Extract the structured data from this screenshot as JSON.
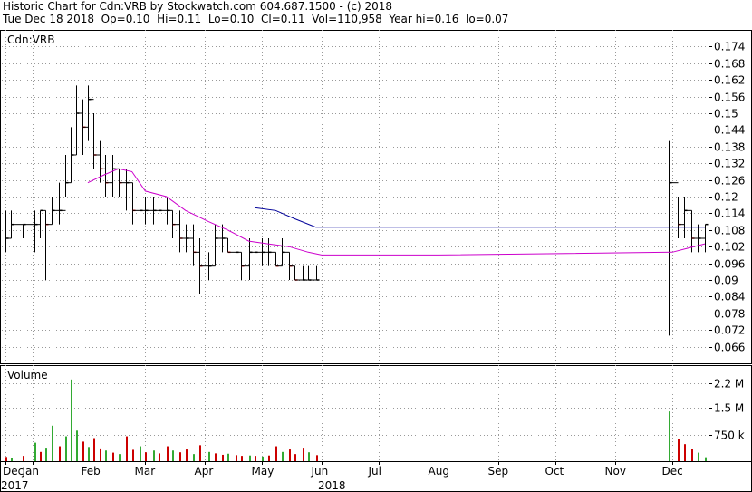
{
  "header": {
    "line1": "Historic Chart for Cdn:VRB by Stockwatch.com 604.687.1500 - (c) 2018",
    "line2": "Tue Dec 18 2018  Op=0.10  Hi=0.11  Lo=0.10  Cl=0.11  Vol=110,958  Year hi=0.16  lo=0.07"
  },
  "colors": {
    "up": "#000000",
    "down": "#cc0000",
    "ma_short": "#cc00cc",
    "ma_long": "#000099",
    "vol_up": "#33aa33",
    "vol_down": "#cc0000",
    "grid": "#999999"
  },
  "chart_data": [
    {
      "type": "ohlc",
      "panel": "price",
      "title": "Cdn:VRB",
      "ylim": [
        0.06,
        0.18
      ],
      "y_ticks": [
        "0.174",
        "0.168",
        "0.162",
        "0.156",
        "0.15",
        "0.144",
        "0.138",
        "0.132",
        "0.126",
        "0.12",
        "0.114",
        "0.108",
        "0.102",
        "0.096",
        "0.09",
        "0.084",
        "0.078",
        "0.072",
        "0.066"
      ],
      "x_ticks": [
        {
          "label": "Dec",
          "date": "2017-12-18"
        },
        {
          "label": "Jan",
          "date": "2018-01-01"
        },
        {
          "label": "Feb",
          "date": "2018-02-01"
        },
        {
          "label": "Mar",
          "date": "2018-03-01"
        },
        {
          "label": "Apr",
          "date": "2018-04-01"
        },
        {
          "label": "May",
          "date": "2018-05-01"
        },
        {
          "label": "Jun",
          "date": "2018-06-01"
        },
        {
          "label": "Jul",
          "date": "2018-07-01"
        },
        {
          "label": "Aug",
          "date": "2018-08-01"
        },
        {
          "label": "Sep",
          "date": "2018-09-01"
        },
        {
          "label": "Oct",
          "date": "2018-10-01"
        },
        {
          "label": "Nov",
          "date": "2018-11-01"
        },
        {
          "label": "Dec",
          "date": "2018-12-01"
        }
      ],
      "year_labels": [
        {
          "label": "2017",
          "date": "2017-12-18"
        },
        {
          "label": "2018",
          "date": "2018-06-01"
        }
      ],
      "x_range": [
        "2017-12-18",
        "2018-12-18"
      ],
      "bars": [
        {
          "date": "2017-12-18",
          "high": 0.115,
          "low": 0.1,
          "close": 0.105
        },
        {
          "date": "2017-12-21",
          "high": 0.115,
          "low": 0.105,
          "close": 0.11
        },
        {
          "date": "2017-12-27",
          "high": 0.11,
          "low": 0.105,
          "close": 0.11
        },
        {
          "date": "2018-01-02",
          "high": 0.115,
          "low": 0.1,
          "close": 0.11
        },
        {
          "date": "2018-01-05",
          "high": 0.115,
          "low": 0.105,
          "close": 0.115
        },
        {
          "date": "2018-01-08",
          "high": 0.115,
          "low": 0.09,
          "close": 0.11
        },
        {
          "date": "2018-01-11",
          "high": 0.12,
          "low": 0.11,
          "close": 0.115
        },
        {
          "date": "2018-01-15",
          "high": 0.125,
          "low": 0.11,
          "close": 0.115
        },
        {
          "date": "2018-01-18",
          "high": 0.135,
          "low": 0.12,
          "close": 0.125
        },
        {
          "date": "2018-01-21",
          "high": 0.145,
          "low": 0.125,
          "close": 0.135
        },
        {
          "date": "2018-01-24",
          "high": 0.16,
          "low": 0.135,
          "close": 0.15
        },
        {
          "date": "2018-01-27",
          "high": 0.155,
          "low": 0.135,
          "close": 0.145
        },
        {
          "date": "2018-01-30",
          "high": 0.16,
          "low": 0.14,
          "close": 0.155
        },
        {
          "date": "2018-02-02",
          "high": 0.15,
          "low": 0.13,
          "close": 0.135
        },
        {
          "date": "2018-02-05",
          "high": 0.14,
          "low": 0.125,
          "close": 0.13
        },
        {
          "date": "2018-02-08",
          "high": 0.135,
          "low": 0.12,
          "close": 0.125
        },
        {
          "date": "2018-02-12",
          "high": 0.135,
          "low": 0.12,
          "close": 0.13
        },
        {
          "date": "2018-02-15",
          "high": 0.13,
          "low": 0.12,
          "close": 0.125
        },
        {
          "date": "2018-02-19",
          "high": 0.13,
          "low": 0.115,
          "close": 0.125
        },
        {
          "date": "2018-02-22",
          "high": 0.125,
          "low": 0.11,
          "close": 0.115
        },
        {
          "date": "2018-02-26",
          "high": 0.12,
          "low": 0.105,
          "close": 0.115
        },
        {
          "date": "2018-03-01",
          "high": 0.12,
          "low": 0.11,
          "close": 0.115
        },
        {
          "date": "2018-03-05",
          "high": 0.12,
          "low": 0.11,
          "close": 0.115
        },
        {
          "date": "2018-03-08",
          "high": 0.12,
          "low": 0.11,
          "close": 0.115
        },
        {
          "date": "2018-03-12",
          "high": 0.12,
          "low": 0.11,
          "close": 0.115
        },
        {
          "date": "2018-03-15",
          "high": 0.115,
          "low": 0.105,
          "close": 0.11
        },
        {
          "date": "2018-03-19",
          "high": 0.115,
          "low": 0.1,
          "close": 0.105
        },
        {
          "date": "2018-03-22",
          "high": 0.11,
          "low": 0.1,
          "close": 0.105
        },
        {
          "date": "2018-03-26",
          "high": 0.11,
          "low": 0.095,
          "close": 0.1
        },
        {
          "date": "2018-03-29",
          "high": 0.105,
          "low": 0.085,
          "close": 0.095
        },
        {
          "date": "2018-04-03",
          "high": 0.1,
          "low": 0.09,
          "close": 0.095
        },
        {
          "date": "2018-04-06",
          "high": 0.11,
          "low": 0.095,
          "close": 0.105
        },
        {
          "date": "2018-04-10",
          "high": 0.11,
          "low": 0.1,
          "close": 0.105
        },
        {
          "date": "2018-04-13",
          "high": 0.105,
          "low": 0.1,
          "close": 0.1
        },
        {
          "date": "2018-04-17",
          "high": 0.105,
          "low": 0.095,
          "close": 0.1
        },
        {
          "date": "2018-04-20",
          "high": 0.1,
          "low": 0.09,
          "close": 0.095
        },
        {
          "date": "2018-04-24",
          "high": 0.105,
          "low": 0.09,
          "close": 0.1
        },
        {
          "date": "2018-04-27",
          "high": 0.105,
          "low": 0.095,
          "close": 0.1
        },
        {
          "date": "2018-05-01",
          "high": 0.105,
          "low": 0.095,
          "close": 0.1
        },
        {
          "date": "2018-05-04",
          "high": 0.105,
          "low": 0.095,
          "close": 0.1
        },
        {
          "date": "2018-05-08",
          "high": 0.1,
          "low": 0.095,
          "close": 0.095
        },
        {
          "date": "2018-05-11",
          "high": 0.105,
          "low": 0.095,
          "close": 0.1
        },
        {
          "date": "2018-05-15",
          "high": 0.1,
          "low": 0.09,
          "close": 0.095
        },
        {
          "date": "2018-05-18",
          "high": 0.095,
          "low": 0.09,
          "close": 0.09
        },
        {
          "date": "2018-05-22",
          "high": 0.095,
          "low": 0.09,
          "close": 0.09
        },
        {
          "date": "2018-05-25",
          "high": 0.095,
          "low": 0.09,
          "close": 0.09
        },
        {
          "date": "2018-05-29",
          "high": 0.095,
          "low": 0.09,
          "close": 0.09
        },
        {
          "date": "2018-11-29",
          "high": 0.14,
          "low": 0.07,
          "close": 0.125
        },
        {
          "date": "2018-12-04",
          "high": 0.12,
          "low": 0.105,
          "close": 0.11
        },
        {
          "date": "2018-12-07",
          "high": 0.12,
          "low": 0.105,
          "close": 0.115
        },
        {
          "date": "2018-12-11",
          "high": 0.115,
          "low": 0.1,
          "close": 0.105
        },
        {
          "date": "2018-12-14",
          "high": 0.11,
          "low": 0.1,
          "close": 0.105
        },
        {
          "date": "2018-12-18",
          "high": 0.11,
          "low": 0.1,
          "close": 0.11
        }
      ],
      "ma_short": [
        [
          "2018-01-30",
          0.125
        ],
        [
          "2018-02-08",
          0.128
        ],
        [
          "2018-02-15",
          0.13
        ],
        [
          "2018-02-22",
          0.129
        ],
        [
          "2018-03-01",
          0.122
        ],
        [
          "2018-03-12",
          0.12
        ],
        [
          "2018-03-22",
          0.115
        ],
        [
          "2018-04-03",
          0.111
        ],
        [
          "2018-04-13",
          0.108
        ],
        [
          "2018-04-24",
          0.104
        ],
        [
          "2018-05-04",
          0.103
        ],
        [
          "2018-05-15",
          0.102
        ],
        [
          "2018-05-25",
          0.1
        ],
        [
          "2018-06-01",
          0.099
        ],
        [
          "2018-08-01",
          0.099
        ],
        [
          "2018-12-01",
          0.1
        ],
        [
          "2018-12-18",
          0.103
        ]
      ],
      "ma_long": [
        [
          "2018-04-27",
          0.116
        ],
        [
          "2018-05-08",
          0.115
        ],
        [
          "2018-05-18",
          0.112
        ],
        [
          "2018-05-29",
          0.109
        ],
        [
          "2018-12-18",
          0.109
        ]
      ]
    },
    {
      "type": "bar",
      "panel": "volume",
      "title": "Volume",
      "ylim": [
        0,
        2500000
      ],
      "y_ticks": [
        "2.2 M",
        "1.5 M",
        "750 k"
      ],
      "bars": [
        {
          "date": "2017-12-18",
          "value": 120000,
          "dir": "down"
        },
        {
          "date": "2017-12-21",
          "value": 90000,
          "dir": "up"
        },
        {
          "date": "2017-12-27",
          "value": 150000,
          "dir": "down"
        },
        {
          "date": "2018-01-02",
          "value": 520000,
          "dir": "up"
        },
        {
          "date": "2018-01-05",
          "value": 260000,
          "dir": "down"
        },
        {
          "date": "2018-01-08",
          "value": 380000,
          "dir": "up"
        },
        {
          "date": "2018-01-11",
          "value": 1000000,
          "dir": "up"
        },
        {
          "date": "2018-01-15",
          "value": 420000,
          "dir": "down"
        },
        {
          "date": "2018-01-18",
          "value": 700000,
          "dir": "up"
        },
        {
          "date": "2018-01-21",
          "value": 2300000,
          "dir": "up"
        },
        {
          "date": "2018-01-24",
          "value": 860000,
          "dir": "up"
        },
        {
          "date": "2018-01-27",
          "value": 550000,
          "dir": "down"
        },
        {
          "date": "2018-01-30",
          "value": 400000,
          "dir": "up"
        },
        {
          "date": "2018-02-02",
          "value": 650000,
          "dir": "down"
        },
        {
          "date": "2018-02-05",
          "value": 360000,
          "dir": "down"
        },
        {
          "date": "2018-02-08",
          "value": 300000,
          "dir": "up"
        },
        {
          "date": "2018-02-12",
          "value": 240000,
          "dir": "down"
        },
        {
          "date": "2018-02-15",
          "value": 200000,
          "dir": "up"
        },
        {
          "date": "2018-02-19",
          "value": 700000,
          "dir": "down"
        },
        {
          "date": "2018-02-22",
          "value": 320000,
          "dir": "down"
        },
        {
          "date": "2018-02-26",
          "value": 420000,
          "dir": "up"
        },
        {
          "date": "2018-03-01",
          "value": 250000,
          "dir": "down"
        },
        {
          "date": "2018-03-05",
          "value": 300000,
          "dir": "up"
        },
        {
          "date": "2018-03-08",
          "value": 220000,
          "dir": "down"
        },
        {
          "date": "2018-03-12",
          "value": 420000,
          "dir": "down"
        },
        {
          "date": "2018-03-15",
          "value": 300000,
          "dir": "up"
        },
        {
          "date": "2018-03-19",
          "value": 250000,
          "dir": "down"
        },
        {
          "date": "2018-03-22",
          "value": 330000,
          "dir": "down"
        },
        {
          "date": "2018-03-26",
          "value": 200000,
          "dir": "up"
        },
        {
          "date": "2018-03-29",
          "value": 450000,
          "dir": "down"
        },
        {
          "date": "2018-04-03",
          "value": 260000,
          "dir": "up"
        },
        {
          "date": "2018-04-06",
          "value": 220000,
          "dir": "down"
        },
        {
          "date": "2018-04-10",
          "value": 180000,
          "dir": "down"
        },
        {
          "date": "2018-04-13",
          "value": 210000,
          "dir": "up"
        },
        {
          "date": "2018-04-17",
          "value": 170000,
          "dir": "down"
        },
        {
          "date": "2018-04-20",
          "value": 150000,
          "dir": "down"
        },
        {
          "date": "2018-04-24",
          "value": 160000,
          "dir": "up"
        },
        {
          "date": "2018-04-27",
          "value": 150000,
          "dir": "down"
        },
        {
          "date": "2018-05-01",
          "value": 130000,
          "dir": "up"
        },
        {
          "date": "2018-05-04",
          "value": 160000,
          "dir": "down"
        },
        {
          "date": "2018-05-08",
          "value": 420000,
          "dir": "down"
        },
        {
          "date": "2018-05-11",
          "value": 260000,
          "dir": "up"
        },
        {
          "date": "2018-05-15",
          "value": 330000,
          "dir": "down"
        },
        {
          "date": "2018-05-18",
          "value": 200000,
          "dir": "down"
        },
        {
          "date": "2018-05-22",
          "value": 380000,
          "dir": "down"
        },
        {
          "date": "2018-05-25",
          "value": 250000,
          "dir": "up"
        },
        {
          "date": "2018-05-29",
          "value": 170000,
          "dir": "down"
        },
        {
          "date": "2018-11-29",
          "value": 1400000,
          "dir": "up"
        },
        {
          "date": "2018-12-04",
          "value": 620000,
          "dir": "down"
        },
        {
          "date": "2018-12-07",
          "value": 480000,
          "dir": "down"
        },
        {
          "date": "2018-12-11",
          "value": 350000,
          "dir": "down"
        },
        {
          "date": "2018-12-14",
          "value": 240000,
          "dir": "up"
        },
        {
          "date": "2018-12-18",
          "value": 110958,
          "dir": "up"
        }
      ]
    }
  ]
}
